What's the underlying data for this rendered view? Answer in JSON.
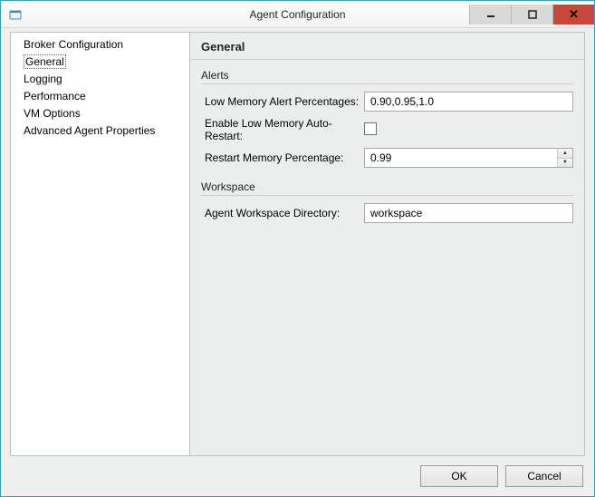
{
  "window": {
    "title": "Agent Configuration"
  },
  "nav": {
    "items": [
      {
        "label": "Broker Configuration",
        "selected": false
      },
      {
        "label": "General",
        "selected": true
      },
      {
        "label": "Logging",
        "selected": false
      },
      {
        "label": "Performance",
        "selected": false
      },
      {
        "label": "VM Options",
        "selected": false
      },
      {
        "label": "Advanced Agent Properties",
        "selected": false
      }
    ]
  },
  "content": {
    "heading": "General",
    "alerts": {
      "group_label": "Alerts",
      "low_mem_label": "Low Memory Alert Percentages:",
      "low_mem_value": "0.90,0.95,1.0",
      "auto_restart_label": "Enable Low Memory Auto-Restart:",
      "auto_restart_checked": false,
      "restart_pct_label": "Restart Memory Percentage:",
      "restart_pct_value": "0.99"
    },
    "workspace": {
      "group_label": "Workspace",
      "dir_label": "Agent Workspace Directory:",
      "dir_value": "workspace"
    }
  },
  "buttons": {
    "ok": "OK",
    "cancel": "Cancel"
  }
}
